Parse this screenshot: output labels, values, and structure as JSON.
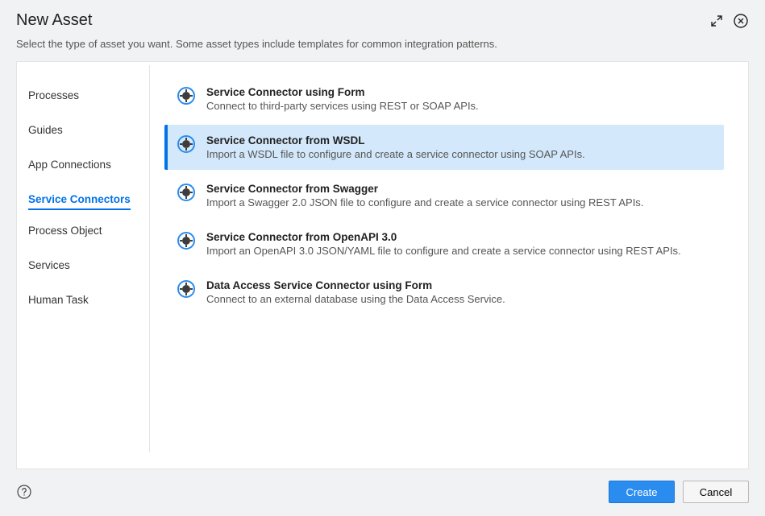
{
  "header": {
    "title": "New Asset"
  },
  "instruction": "Select the type of asset you want. Some asset types include templates for common integration patterns.",
  "sidebar": {
    "items": [
      {
        "label": "Processes"
      },
      {
        "label": "Guides"
      },
      {
        "label": "App Connections"
      },
      {
        "label": "Service Connectors"
      },
      {
        "label": "Process Object"
      },
      {
        "label": "Services"
      },
      {
        "label": "Human Task"
      }
    ],
    "selected_index": 3
  },
  "assets": [
    {
      "title": "Service Connector using Form",
      "description": "Connect to third-party services using REST or SOAP APIs."
    },
    {
      "title": "Service Connector from WSDL",
      "description": "Import a WSDL file to configure and create a service connector using SOAP APIs."
    },
    {
      "title": "Service Connector from Swagger",
      "description": "Import a Swagger 2.0 JSON file to configure and create a service connector using REST APIs."
    },
    {
      "title": "Service Connector from OpenAPI 3.0",
      "description": "Import an OpenAPI 3.0 JSON/YAML file to configure and create a service connector using REST APIs."
    },
    {
      "title": "Data Access Service Connector using Form",
      "description": "Connect to an external database using the Data Access Service."
    }
  ],
  "assets_selected_index": 1,
  "footer": {
    "create_label": "Create",
    "cancel_label": "Cancel"
  }
}
